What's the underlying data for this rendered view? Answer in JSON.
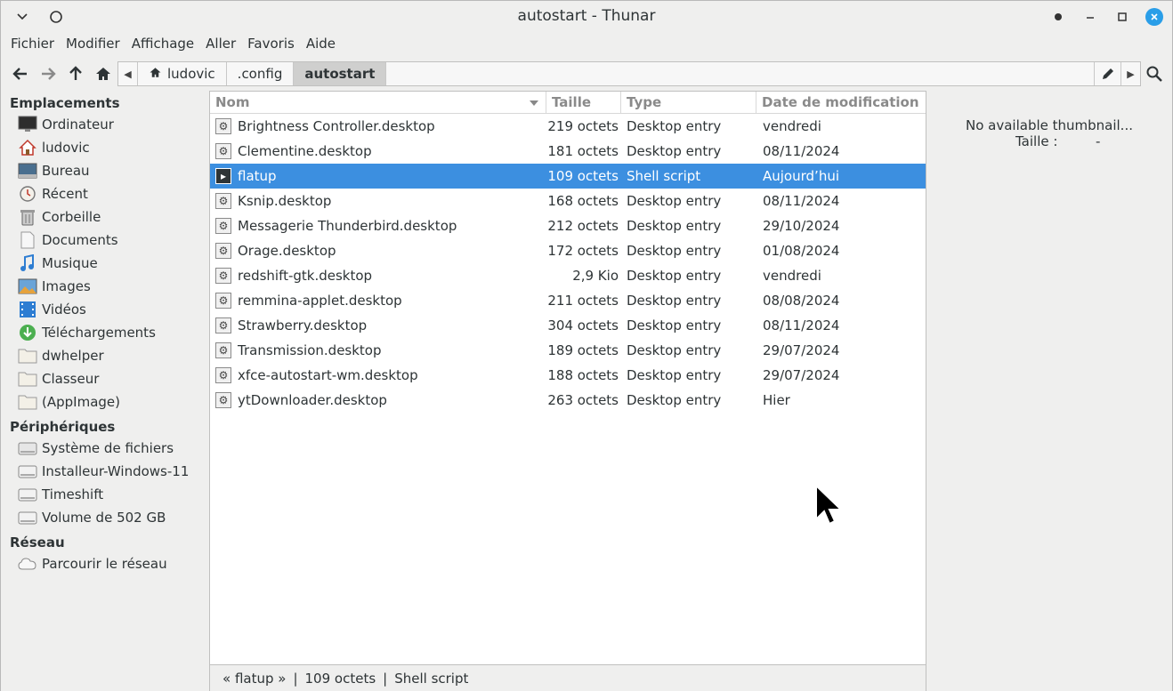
{
  "window": {
    "title": "autostart - Thunar"
  },
  "menu": [
    "Fichier",
    "Modifier",
    "Affichage",
    "Aller",
    "Favoris",
    "Aide"
  ],
  "pathbar": {
    "crumbs": [
      "ludovic",
      ".config",
      "autostart"
    ]
  },
  "sidebar": {
    "places_heading": "Emplacements",
    "places": [
      {
        "label": "Ordinateur",
        "icon": "computer-icon"
      },
      {
        "label": "ludovic",
        "icon": "home-icon"
      },
      {
        "label": "Bureau",
        "icon": "desktop-icon"
      },
      {
        "label": "Récent",
        "icon": "recent-icon"
      },
      {
        "label": "Corbeille",
        "icon": "trash-icon"
      },
      {
        "label": "Documents",
        "icon": "documents-icon"
      },
      {
        "label": "Musique",
        "icon": "music-icon"
      },
      {
        "label": "Images",
        "icon": "images-icon"
      },
      {
        "label": "Vidéos",
        "icon": "videos-icon"
      },
      {
        "label": "Téléchargements",
        "icon": "downloads-icon"
      },
      {
        "label": "dwhelper",
        "icon": "folder-icon"
      },
      {
        "label": "Classeur",
        "icon": "folder-icon"
      },
      {
        "label": "(AppImage)",
        "icon": "folder-icon"
      }
    ],
    "devices_heading": "Périphériques",
    "devices": [
      {
        "label": "Système de fichiers",
        "icon": "drive-icon"
      },
      {
        "label": "Installeur-Windows-11",
        "icon": "drive-icon"
      },
      {
        "label": "Timeshift",
        "icon": "drive-icon"
      },
      {
        "label": "Volume de 502 GB",
        "icon": "drive-icon"
      }
    ],
    "network_heading": "Réseau",
    "network": [
      {
        "label": "Parcourir le réseau",
        "icon": "network-icon"
      }
    ]
  },
  "columns": {
    "name": "Nom",
    "size": "Taille",
    "type": "Type",
    "date": "Date de modification"
  },
  "files": [
    {
      "name": "Brightness Controller.desktop",
      "size": "219 octets",
      "type": "Desktop entry",
      "date": "vendredi",
      "icon": "desktop-entry-icon"
    },
    {
      "name": "Clementine.desktop",
      "size": "181 octets",
      "type": "Desktop entry",
      "date": "08/11/2024",
      "icon": "desktop-entry-icon"
    },
    {
      "name": "flatup",
      "size": "109 octets",
      "type": "Shell script",
      "date": "Aujourd’hui",
      "icon": "shell-script-icon",
      "selected": true
    },
    {
      "name": "Ksnip.desktop",
      "size": "168 octets",
      "type": "Desktop entry",
      "date": "08/11/2024",
      "icon": "desktop-entry-icon"
    },
    {
      "name": "Messagerie Thunderbird.desktop",
      "size": "212 octets",
      "type": "Desktop entry",
      "date": "29/10/2024",
      "icon": "desktop-entry-icon"
    },
    {
      "name": "Orage.desktop",
      "size": "172 octets",
      "type": "Desktop entry",
      "date": "01/08/2024",
      "icon": "desktop-entry-icon"
    },
    {
      "name": "redshift-gtk.desktop",
      "size": "2,9 Kio",
      "type": "Desktop entry",
      "date": "vendredi",
      "icon": "desktop-entry-icon"
    },
    {
      "name": "remmina-applet.desktop",
      "size": "211 octets",
      "type": "Desktop entry",
      "date": "08/08/2024",
      "icon": "desktop-entry-icon"
    },
    {
      "name": "Strawberry.desktop",
      "size": "304 octets",
      "type": "Desktop entry",
      "date": "08/11/2024",
      "icon": "desktop-entry-icon"
    },
    {
      "name": "Transmission.desktop",
      "size": "189 octets",
      "type": "Desktop entry",
      "date": "29/07/2024",
      "icon": "desktop-entry-icon"
    },
    {
      "name": "xfce-autostart-wm.desktop",
      "size": "188 octets",
      "type": "Desktop entry",
      "date": "29/07/2024",
      "icon": "desktop-entry-icon"
    },
    {
      "name": "ytDownloader.desktop",
      "size": "263 octets",
      "type": "Desktop entry",
      "date": "Hier",
      "icon": "desktop-entry-icon"
    }
  ],
  "statusbar": {
    "name": "« flatup »",
    "size": "109 octets",
    "type": "Shell script"
  },
  "preview": {
    "title": "No available thumbnail...",
    "size_label": "Taille :",
    "size_value": "-"
  },
  "colors": {
    "selection": "#3c8fe0",
    "close_button": "#2a9ee8"
  }
}
